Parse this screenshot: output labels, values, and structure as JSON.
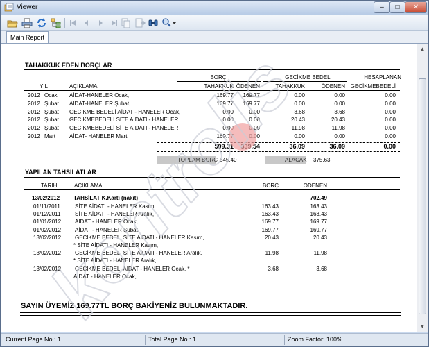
{
  "window": {
    "title": "Viewer",
    "min_glyph": "–",
    "max_glyph": "□",
    "close_glyph": "✕"
  },
  "toolbar": {
    "icons": [
      "open-icon",
      "print-icon",
      "refresh-icon",
      "tree-icon",
      "first-page-icon",
      "prev-page-icon",
      "next-page-icon",
      "last-page-icon",
      "copy-icon",
      "export-icon",
      "find-icon",
      "zoom-icon"
    ]
  },
  "tabs": [
    {
      "label": "Main Report"
    }
  ],
  "report": {
    "debts": {
      "title": "TAHAKKUK EDEN BORÇLAR",
      "group_borc": "BORÇ",
      "group_gecikme": "GECİKME BEDELİ",
      "group_hesap": "HESAPLANAN",
      "col_yil": "YIL",
      "col_aciklama": "AÇIKLAMA",
      "col_tahakkuk": "TAHAKKUK",
      "col_odenen": "ÖDENEN",
      "col_g_tahakkuk": "TAHAKKUK",
      "col_g_odenen": "ÖDENEN",
      "col_gecikme": "GECİKMEBEDELİ",
      "rows": [
        {
          "yil": "2012",
          "ay": "Ocak",
          "aciklama": "AİDAT-HANELER Ocak,",
          "tahakkuk": "169.77",
          "odenen": "169.77",
          "g_tahakkuk": "0.00",
          "g_odenen": "0.00",
          "gecikme": "0.00"
        },
        {
          "yil": "2012",
          "ay": "Şubat",
          "aciklama": "AİDAT-HANELER Şubat,",
          "tahakkuk": "169.77",
          "odenen": "169.77",
          "g_tahakkuk": "0.00",
          "g_odenen": "0.00",
          "gecikme": "0.00"
        },
        {
          "yil": "2012",
          "ay": "Şubat",
          "aciklama": "GECİKME BEDELİ AİDAT - HANELER Ocak,",
          "tahakkuk": "0.00",
          "odenen": "0.00",
          "g_tahakkuk": "3.68",
          "g_odenen": "3.68",
          "gecikme": "0.00"
        },
        {
          "yil": "2012",
          "ay": "Şubat",
          "aciklama": "GECİKMEBEDELİ SİTE AİDATI - HANELER",
          "tahakkuk": "0.00",
          "odenen": "0.00",
          "g_tahakkuk": "20.43",
          "g_odenen": "20.43",
          "gecikme": "0.00"
        },
        {
          "yil": "2012",
          "ay": "Şubat",
          "aciklama": "GECİKMEBEDELİ SİTE AİDATI - HANELER",
          "tahakkuk": "0.00",
          "odenen": "0.00",
          "g_tahakkuk": "11.98",
          "g_odenen": "11.98",
          "gecikme": "0.00"
        },
        {
          "yil": "2012",
          "ay": "Mart",
          "aciklama": "AİDAT- HANELER Mart",
          "tahakkuk": "169.77",
          "odenen": "0.00",
          "g_tahakkuk": "0.00",
          "g_odenen": "0.00",
          "gecikme": "0.00"
        }
      ],
      "totals": {
        "tahakkuk": "509.31",
        "odenen": "339.54",
        "g_tahakkuk": "36.09",
        "g_odenen": "36.09",
        "gecikme": "0.00"
      },
      "toplam_borc_label": "TOPLAM BORÇ",
      "toplam_borc_value": "545.40",
      "alacak_label": "ALACAK",
      "alacak_value": "375.63"
    },
    "payments": {
      "title": "YAPILAN TAHSİLATLAR",
      "col_tarih": "TARİH",
      "col_aciklama": "AÇIKLAMA",
      "col_borc": "BORÇ",
      "col_odenen": "ÖDENEN",
      "header_row": {
        "tarih": "13/02/2012",
        "aciklama": "TAHSİLAT K.Kartı (nakit)",
        "odenen": "702.49"
      },
      "rows": [
        {
          "tarih": "01/11/2011",
          "aciklama": "SİTE AİDATI - HANELER Kasım,",
          "borc": "163.43",
          "odenen": "163.43"
        },
        {
          "tarih": "01/12/2011",
          "aciklama": "SİTE AİDATI - HANELER Aralık,",
          "borc": "163.43",
          "odenen": "163.43"
        },
        {
          "tarih": "01/01/2012",
          "aciklama": "AİDAT - HANELER Ocak,",
          "borc": "169.77",
          "odenen": "169.77"
        },
        {
          "tarih": "01/02/2012",
          "aciklama": "AİDAT - HANELER Şubat,",
          "borc": "169.77",
          "odenen": "169.77"
        },
        {
          "tarih": "13/02/2012",
          "aciklama": "GECİKME BEDELİ  SİTE AİDATI - HANELER Kasım,",
          "aciklama2": "* SİTE AİDATI - HANELER Kasım,",
          "borc": "20.43",
          "odenen": "20.43"
        },
        {
          "tarih": "13/02/2012",
          "aciklama": "GECİKME BEDELİ  SİTE AİDATI - HANELER Aralık,",
          "aciklama2": "* SİTE AİDATI - HANELER Aralık,",
          "borc": "11.98",
          "odenen": "11.98"
        },
        {
          "tarih": "13/02/2012",
          "aciklama": "GECİKME BEDELİ  AİDAT - HANELER Ocak, *",
          "aciklama2": "AİDAT - HANELER Ocak,",
          "borc": "3.68",
          "odenen": "3.68"
        }
      ]
    },
    "footer_message": "SAYIN ÜYEMİZ 169.77TL BORÇ BAKİYENİZ BULUNMAKTADIR."
  },
  "watermark_text": "kontrolis",
  "status": {
    "current_page": "Current Page No.: 1",
    "total_page": "Total Page No.: 1",
    "zoom": "Zoom Factor: 100%"
  }
}
